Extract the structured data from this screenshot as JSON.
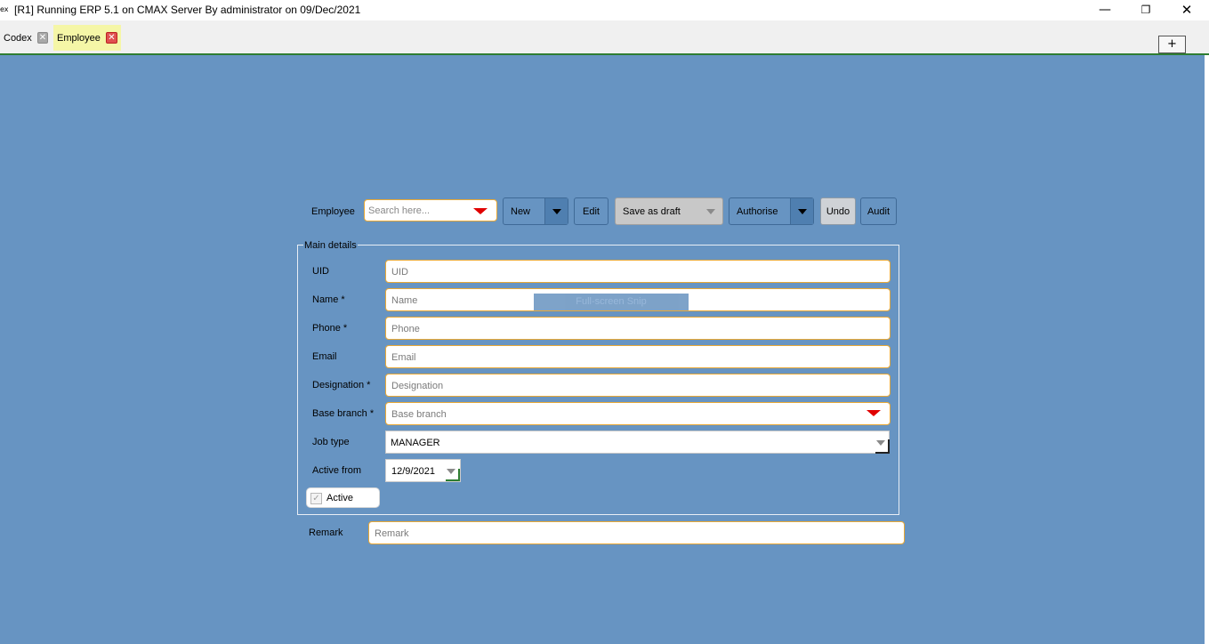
{
  "window": {
    "app_icon": "ex",
    "title": "[R1] Running ERP 5.1 on CMAX Server By administrator on 09/Dec/2021",
    "minimize": "—",
    "restore": "❐",
    "close": "✕"
  },
  "tabs": [
    {
      "label": "Codex",
      "close": "✕",
      "active": false
    },
    {
      "label": "Employee",
      "close": "✕",
      "active": true
    }
  ],
  "add_tab": "+",
  "toolbar": {
    "employee_label": "Employee",
    "search_placeholder": "Search here...",
    "new_label": "New",
    "edit_label": "Edit",
    "save_draft_label": "Save as draft",
    "authorise_label": "Authorise",
    "undo_label": "Undo",
    "audit_label": "Audit"
  },
  "main_details": {
    "legend": "Main details",
    "uid": {
      "label": "UID",
      "placeholder": "UID",
      "value": ""
    },
    "name": {
      "label": "Name *",
      "placeholder": "Name",
      "value": ""
    },
    "phone": {
      "label": "Phone *",
      "placeholder": "Phone",
      "value": ""
    },
    "email": {
      "label": "Email",
      "placeholder": "Email",
      "value": ""
    },
    "designation": {
      "label": "Designation *",
      "placeholder": "Designation",
      "value": ""
    },
    "base_branch": {
      "label": "Base branch *",
      "placeholder": "Base branch",
      "value": ""
    },
    "job_type": {
      "label": "Job type",
      "value": "MANAGER"
    },
    "active_from": {
      "label": "Active from",
      "value": "12/9/2021"
    },
    "active": {
      "label": "Active",
      "checked": true,
      "mark": "✓"
    }
  },
  "remark": {
    "label": "Remark",
    "placeholder": "Remark",
    "value": ""
  },
  "overlay_text": "Full-screen Snip",
  "colors": {
    "background": "#6794c2",
    "field_border": "#e8a836",
    "dropdown_arrow": "#e00000",
    "active_tab": "#f5f6a7",
    "tab_underline": "#2e7d32"
  }
}
